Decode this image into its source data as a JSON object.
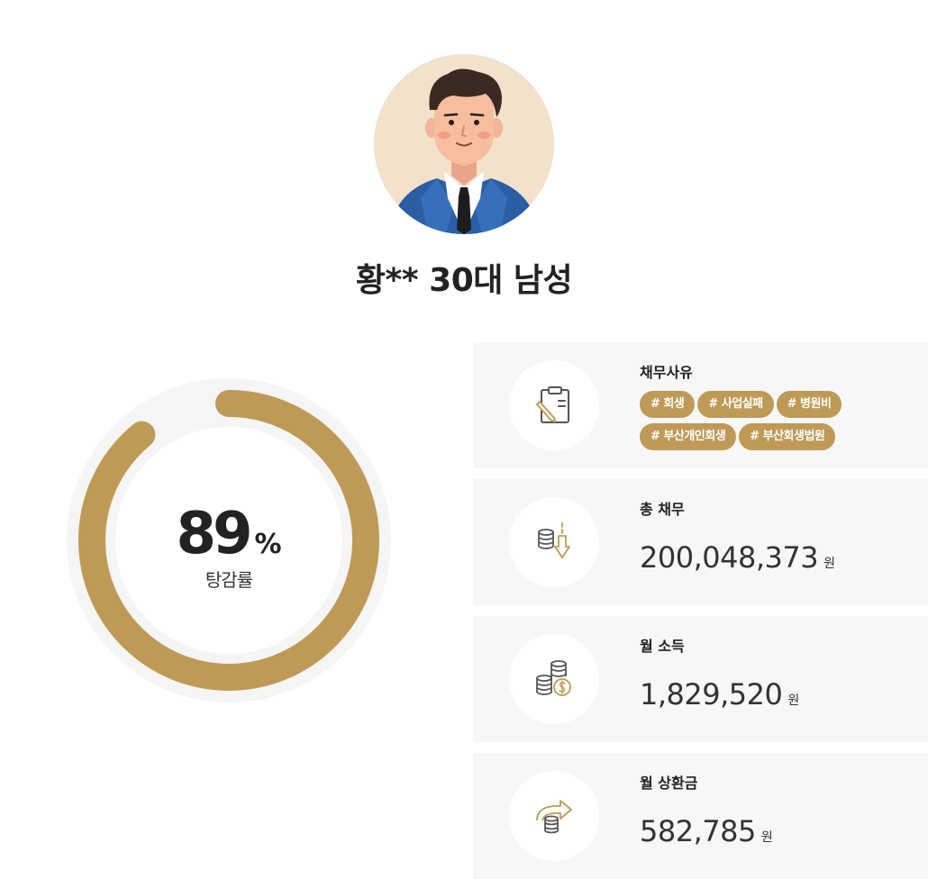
{
  "profile": {
    "name": "황** 30대 남성"
  },
  "gauge": {
    "percent": 89,
    "value_text": "89",
    "unit": "%",
    "label": "탕감률",
    "accent_color": "#bf9a56",
    "track_color": "#f5f5f5"
  },
  "debt_reason": {
    "title": "채무사유",
    "tags_row1": [
      "# 회생",
      "# 사업실패",
      "# 병원비"
    ],
    "tags_row2": [
      "# 부산개인회생",
      "# 부산회생법원"
    ],
    "icon": "clipboard-pencil-icon"
  },
  "total_debt": {
    "title": "총 채무",
    "amount": "200,048,373",
    "unit": "원",
    "icon": "coins-down-arrow-icon"
  },
  "monthly_income": {
    "title": "월 소득",
    "amount": "1,829,520",
    "unit": "원",
    "icon": "coin-stacks-icon"
  },
  "monthly_repayment": {
    "title": "월 상환금",
    "amount": "582,785",
    "unit": "원",
    "icon": "coins-forward-arrow-icon"
  }
}
